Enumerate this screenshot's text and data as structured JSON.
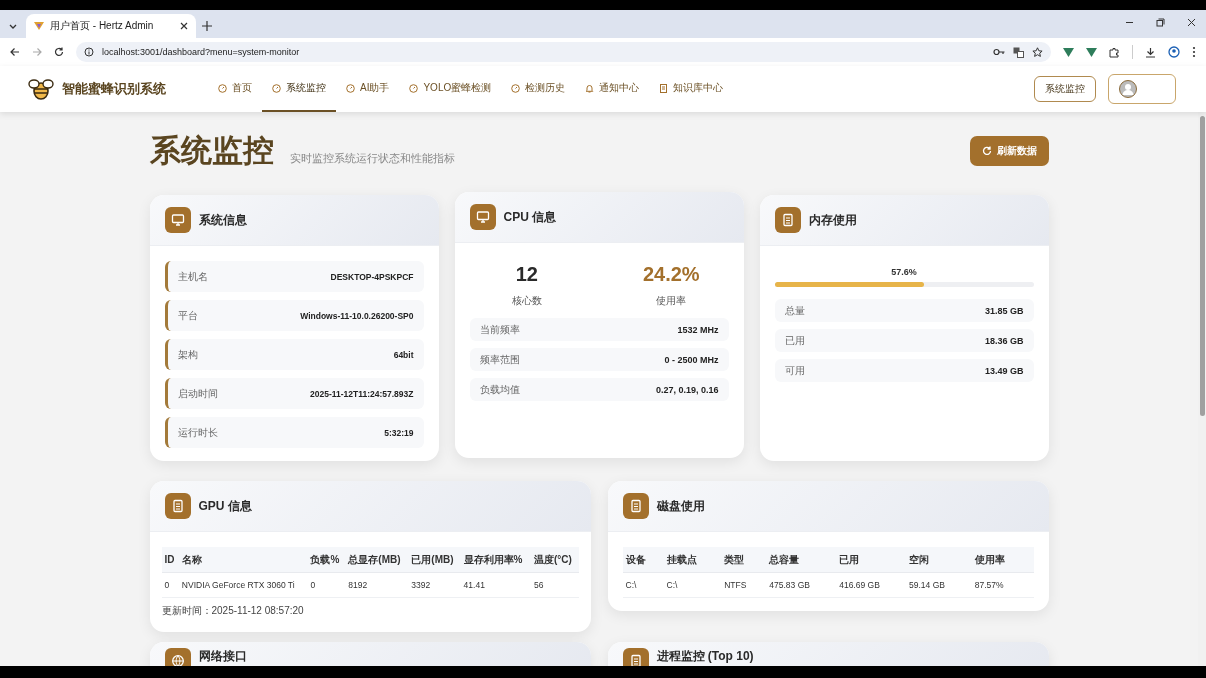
{
  "browser": {
    "tab_title": "用户首页 - Hertz Admin",
    "url": "localhost:3001/dashboard?menu=system-monitor"
  },
  "header": {
    "brand": "智能蜜蜂识别系统",
    "nav": [
      {
        "label": "首页",
        "selected": false
      },
      {
        "label": "系统监控",
        "selected": true
      },
      {
        "label": "AI助手",
        "selected": false
      },
      {
        "label": "YOLO蜜蜂检测",
        "selected": false
      },
      {
        "label": "检测历史",
        "selected": false
      },
      {
        "label": "通知中心",
        "selected": false
      },
      {
        "label": "知识库中心",
        "selected": false
      }
    ],
    "action_button": "系统监控"
  },
  "page": {
    "title": "系统监控",
    "subtitle": "实时监控系统运行状态和性能指标",
    "refresh_button": "刷新数据"
  },
  "system_info": {
    "title": "系统信息",
    "rows": [
      {
        "label": "主机名",
        "value": "DESKTOP-4PSKPCF"
      },
      {
        "label": "平台",
        "value": "Windows-11-10.0.26200-SP0"
      },
      {
        "label": "架构",
        "value": "64bit"
      },
      {
        "label": "启动时间",
        "value": "2025-11-12T11:24:57.893Z"
      },
      {
        "label": "运行时长",
        "value": "5:32:19"
      }
    ]
  },
  "cpu": {
    "title": "CPU 信息",
    "stats": [
      {
        "kind": "count",
        "value": "12",
        "label": "核心数"
      },
      {
        "kind": "percent",
        "value": "24.2%",
        "label": "使用率"
      }
    ],
    "rows": [
      {
        "label": "当前频率",
        "value": "1532 MHz"
      },
      {
        "label": "频率范围",
        "value": "0 - 2500 MHz"
      },
      {
        "label": "负载均值",
        "value": "0.27, 0.19, 0.16"
      }
    ]
  },
  "memory": {
    "title": "内存使用",
    "level": 0.576,
    "reading": "57.6%",
    "rows": [
      {
        "label": "总量",
        "value": "31.85 GB"
      },
      {
        "label": "已用",
        "value": "18.36 GB"
      },
      {
        "label": "可用",
        "value": "13.49 GB"
      }
    ]
  },
  "gpu": {
    "title": "GPU 信息",
    "table": {
      "columns": [
        "ID",
        "名称",
        "负载%",
        "总显存(MB)",
        "已用(MB)",
        "显存利用率%",
        "温度(°C)"
      ],
      "rows": [
        [
          "0",
          "NVIDIA GeForce RTX 3060 Ti",
          "0",
          "8192",
          "3392",
          "41.41",
          "56"
        ]
      ]
    },
    "updated": "更新时间：2025-11-12 08:57:20"
  },
  "disk": {
    "title": "磁盘使用",
    "table": {
      "columns": [
        "设备",
        "挂载点",
        "类型",
        "总容量",
        "已用",
        "空闲",
        "使用率"
      ],
      "rows": [
        [
          "C:\\",
          "C:\\",
          "NTFS",
          "475.83 GB",
          "416.69 GB",
          "59.14 GB",
          "87.57%"
        ]
      ]
    }
  },
  "lower_cards": [
    {
      "title": "网络接口"
    },
    {
      "title": "进程监控 (Top 10)"
    }
  ]
}
